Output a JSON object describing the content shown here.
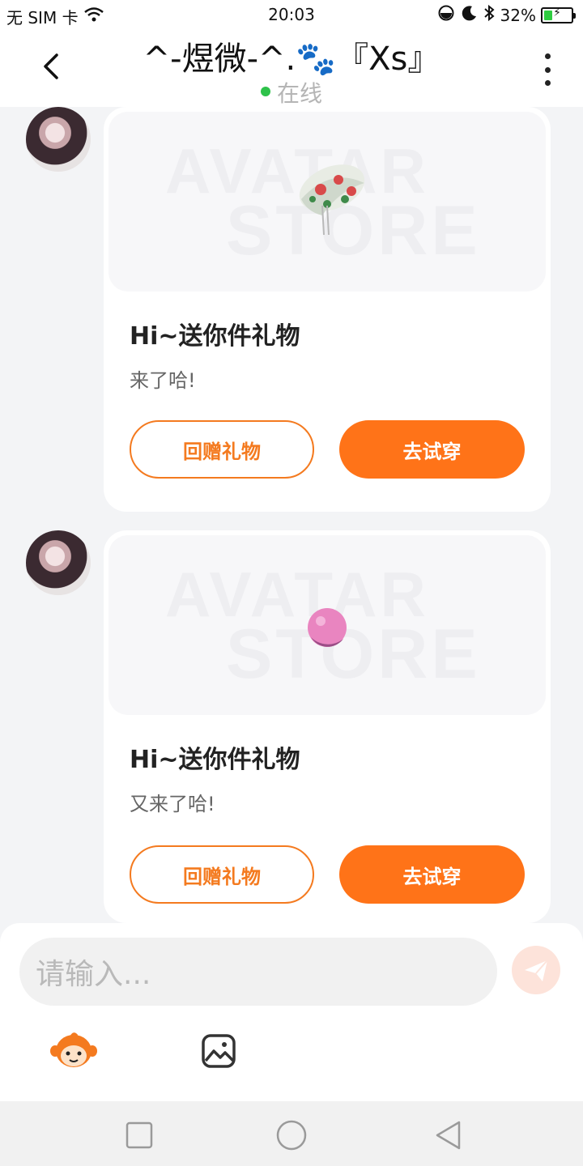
{
  "status_bar": {
    "carrier": "无 SIM 卡",
    "time": "20:03",
    "battery_percent": "32%",
    "battery_level": 0.32,
    "icons": [
      "wifi-icon",
      "alarm-icon",
      "moon-icon",
      "bluetooth-icon",
      "battery-icon"
    ]
  },
  "header": {
    "title": "^-煜微-^.🐾『Xs』",
    "status": "在线",
    "status_color": "#2ec24a"
  },
  "messages": [
    {
      "gift_image": "gift-hat",
      "watermark_1": "AVATAR",
      "watermark_2": "STORE",
      "title": "Hi~送你件礼物",
      "subtitle": "来了哈!",
      "return_label": "回赠礼物",
      "try_label": "去试穿"
    },
    {
      "gift_image": "gift-ball",
      "watermark_1": "AVATAR",
      "watermark_2": "STORE",
      "title": "Hi~送你件礼物",
      "subtitle": "又来了哈!",
      "return_label": "回赠礼物",
      "try_label": "去试穿"
    }
  ],
  "composer": {
    "placeholder": "请输入..."
  },
  "colors": {
    "accent": "#ff7318",
    "accent_outline": "#f47a1f",
    "background": "#f3f4f6"
  }
}
